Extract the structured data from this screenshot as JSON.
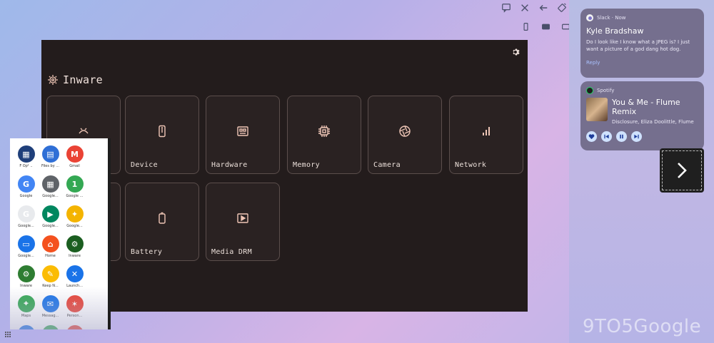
{
  "window_controls": {
    "icons": [
      "feedback-icon",
      "close-icon",
      "back-icon",
      "rotate-icon"
    ]
  },
  "size_controls": {
    "icons": [
      "phone-size-icon",
      "tablet-size-icon",
      "desktop-size-icon"
    ]
  },
  "app": {
    "title": "Inware",
    "tiles": [
      {
        "label": "",
        "icon": "system-icon"
      },
      {
        "label": "Device",
        "icon": "device-icon"
      },
      {
        "label": "Hardware",
        "icon": "hardware-icon"
      },
      {
        "label": "Memory",
        "icon": "memory-icon"
      },
      {
        "label": "Camera",
        "icon": "camera-icon"
      },
      {
        "label": "Network",
        "icon": "network-icon"
      },
      {
        "label": "",
        "icon": "blank-icon"
      },
      {
        "label": "Battery",
        "icon": "battery-icon"
      },
      {
        "label": "Media DRM",
        "icon": "media-drm-icon"
      }
    ],
    "colors": {
      "background": "#231c1c",
      "accent": "#efc6b6"
    }
  },
  "launcher": {
    "apps": [
      {
        "name": "F Opt...",
        "color": "#1f3f7a",
        "glyph": "▦"
      },
      {
        "name": "Files by ...",
        "color": "#2f6fd6",
        "glyph": "▤"
      },
      {
        "name": "Gmail",
        "color": "#ea4335",
        "glyph": "M"
      },
      {
        "name": "Google",
        "color": "#4285f4",
        "glyph": "G"
      },
      {
        "name": "Google...",
        "color": "#5f6368",
        "glyph": "▦"
      },
      {
        "name": "Google ...",
        "color": "#34a853",
        "glyph": "1"
      },
      {
        "name": "Google...",
        "color": "#e8eaed",
        "glyph": "G"
      },
      {
        "name": "Google...",
        "color": "#01875f",
        "glyph": "▶"
      },
      {
        "name": "Google...",
        "color": "#f4b400",
        "glyph": "✦"
      },
      {
        "name": "Google...",
        "color": "#1a73e8",
        "glyph": "▭"
      },
      {
        "name": "Home",
        "color": "#f4511e",
        "glyph": "⌂"
      },
      {
        "name": "Inware",
        "color": "#1b5e20",
        "glyph": "⚙"
      },
      {
        "name": "Inware",
        "color": "#2e7d32",
        "glyph": "⚙"
      },
      {
        "name": "Keep N...",
        "color": "#fbbc04",
        "glyph": "✎"
      },
      {
        "name": "Launch...",
        "color": "#1a73e8",
        "glyph": "✕"
      },
      {
        "name": "Maps",
        "color": "#34a853",
        "glyph": "⌖"
      },
      {
        "name": "Messag...",
        "color": "#1a73e8",
        "glyph": "✉"
      },
      {
        "name": "Person...",
        "color": "#ea4335",
        "glyph": "✶"
      },
      {
        "name": "",
        "color": "#1a73e8",
        "glyph": ""
      },
      {
        "name": "",
        "color": "#34a853",
        "glyph": ""
      },
      {
        "name": "",
        "color": "#ea4335",
        "glyph": ""
      }
    ]
  },
  "notifications": {
    "slack": {
      "source": "Slack · Now",
      "title": "Kyle Bradshaw",
      "body": "Do I look like I know what a JPEG is? I just want a picture of a god dang hot dog.",
      "reply": "Reply"
    },
    "spotify": {
      "source": "Spotify",
      "track": "You & Me - Flume Remix",
      "artist": "Disclosure, Eliza Doolittle, Flume",
      "controls": [
        "heart-icon",
        "previous-icon",
        "pause-icon",
        "next-icon"
      ]
    }
  },
  "watermark": "9TO5Google"
}
